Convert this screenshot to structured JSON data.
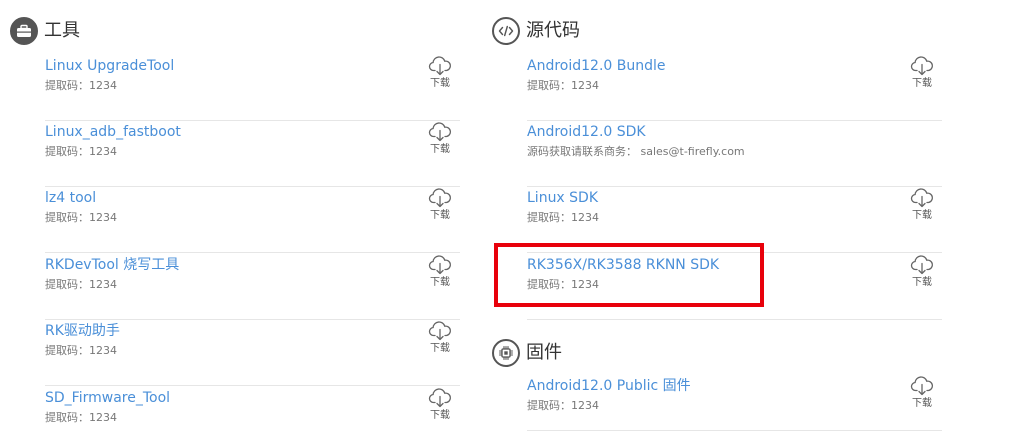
{
  "tools": {
    "title": "工具",
    "items": [
      {
        "title": "Linux UpgradeTool",
        "sub": "提取码：1234",
        "download": "下载"
      },
      {
        "title": "Linux_adb_fastboot",
        "sub": "提取码：1234",
        "download": "下载"
      },
      {
        "title": "lz4 tool",
        "sub": "提取码：1234",
        "download": "下载"
      },
      {
        "title": "RKDevTool 烧写工具",
        "sub": "提取码：1234",
        "download": "下载"
      },
      {
        "title": "RK驱动助手",
        "sub": "提取码：1234",
        "download": "下载"
      },
      {
        "title": "SD_Firmware_Tool",
        "sub": "提取码：1234",
        "download": "下载"
      }
    ]
  },
  "source": {
    "title": "源代码",
    "items": [
      {
        "title": "Android12.0 Bundle",
        "sub": "提取码：1234",
        "download": "下载"
      },
      {
        "title": "Android12.0 SDK",
        "sub": "源码获取请联系商务：  sales@t-firefly.com"
      },
      {
        "title": "Linux SDK",
        "sub": "提取码：1234",
        "download": "下载"
      },
      {
        "title": "RK356X/RK3588 RKNN SDK",
        "sub": "提取码：1234",
        "download": "下载"
      }
    ]
  },
  "firmware": {
    "title": "固件",
    "items": [
      {
        "title": "Android12.0 Public 固件",
        "sub": "提取码：1234",
        "download": "下载"
      }
    ]
  },
  "colors": {
    "link": "#4a8fd8",
    "highlight": "#e8000b"
  }
}
